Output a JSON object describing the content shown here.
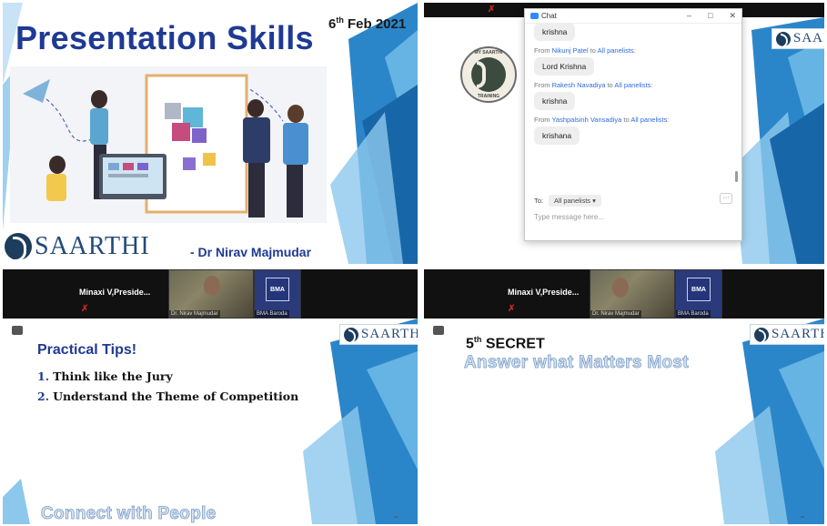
{
  "q1": {
    "title": "Presentation Skills",
    "date_day": "6",
    "date_suffix": "th",
    "date_rest": " Feb 2021",
    "logo_word": "SAARTHI",
    "author": "- Dr Nirav Majmudar"
  },
  "q2": {
    "logo_word": "SAARTHI",
    "circle_top": "MY SAARTHI",
    "circle_bottom": "TRAINING",
    "chat": {
      "title": "Chat",
      "messages": [
        {
          "text": "krishna"
        },
        {
          "from_prefix": "From",
          "sender": "Nikunj Patel",
          "to_word": "to",
          "recipient": "All panelists",
          "text": "Lord Krishna"
        },
        {
          "from_prefix": "From",
          "sender": "Rakesh Navadiya",
          "to_word": "to",
          "recipient": "All panelists",
          "text": "krishna"
        },
        {
          "from_prefix": "From",
          "sender": "Yashpalsinh Vansadiya",
          "to_word": "to",
          "recipient": "All panelists",
          "text": "krishana"
        }
      ],
      "to_label": "To:",
      "to_value": "All panelists",
      "input_placeholder": "Type message here..."
    }
  },
  "q3": {
    "participant": "Minaxi  V,Preside...",
    "video_name": "Dr. Nirav Majmudar",
    "bma_name": "BMA Baroda",
    "bma_logo": "BMA",
    "logo_word": "SAARTHI",
    "heading": "Practical Tips!",
    "items": [
      {
        "num": "1.",
        "text": "Think like the Jury"
      },
      {
        "num": "2.",
        "text": "Understand the Theme of Competition"
      }
    ],
    "footer": "Connect with People"
  },
  "q4": {
    "participant": "Minaxi  V,Preside...",
    "video_name": "Dr. Nirav Majmudar",
    "bma_name": "BMA Baroda",
    "bma_logo": "BMA",
    "logo_word": "SAARTHI",
    "heading_num": "5",
    "heading_sup": "th",
    "heading_rest": " SECRET",
    "subheading": "Answer what Matters Most"
  },
  "colors": {
    "title_blue": "#1f3a93",
    "shard_blue": "#4aa3df",
    "zoom_blue": "#2d8cff"
  }
}
